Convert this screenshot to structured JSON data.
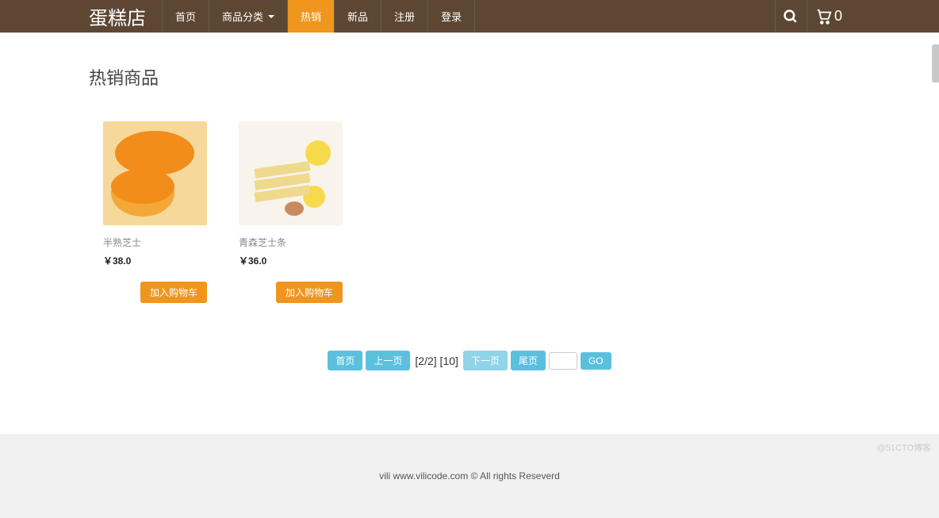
{
  "nav": {
    "brand": "蛋糕店",
    "items": [
      {
        "label": "首页",
        "active": false
      },
      {
        "label": "商品分类",
        "active": false,
        "dropdown": true
      },
      {
        "label": "热销",
        "active": true
      },
      {
        "label": "新品",
        "active": false
      },
      {
        "label": "注册",
        "active": false
      },
      {
        "label": "登录",
        "active": false
      }
    ],
    "cart_count": "0"
  },
  "page": {
    "title": "热销商品"
  },
  "products": [
    {
      "name": "半熟芝士",
      "price": "￥38.0",
      "add_label": "加入购物车"
    },
    {
      "name": "青森芝士条",
      "price": "￥36.0",
      "add_label": "加入购物车"
    }
  ],
  "pagination": {
    "first": "首页",
    "prev": "上一页",
    "info": "[2/2] [10]",
    "next": "下一页",
    "last": "尾页",
    "go": "GO"
  },
  "footer": {
    "text": "vili www.vilicode.com © All rights Reseverd"
  },
  "watermark": "@51CTO博客"
}
